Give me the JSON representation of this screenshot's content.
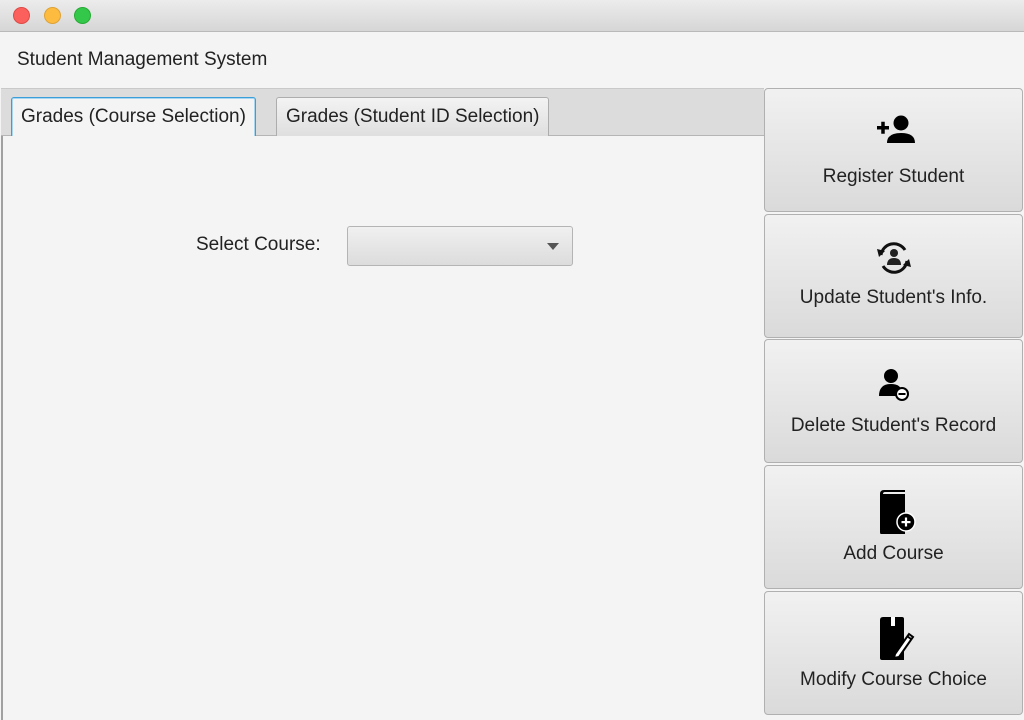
{
  "window": {
    "controls": [
      "close",
      "minimize",
      "zoom"
    ],
    "title": "Student Management System"
  },
  "tabs": [
    {
      "label": "Grades (Course Selection)",
      "active": true
    },
    {
      "label": "Grades (Student ID Selection)",
      "active": false
    }
  ],
  "course_tab": {
    "select_label": "Select Course:",
    "selected_value": ""
  },
  "sidebar": {
    "buttons": [
      {
        "label": "Register Student",
        "icon": "add-user-icon"
      },
      {
        "label": "Update Student's Info.",
        "icon": "refresh-user-icon"
      },
      {
        "label": "Delete Student's Record",
        "icon": "remove-user-icon"
      },
      {
        "label": "Add Course",
        "icon": "add-book-icon"
      },
      {
        "label": "Modify Course Choice",
        "icon": "edit-book-icon"
      }
    ]
  },
  "colors": {
    "active_tab_border": "#3a9fd8",
    "close": "#fc605c",
    "minimize": "#fdbc40",
    "zoom": "#34c84a"
  }
}
